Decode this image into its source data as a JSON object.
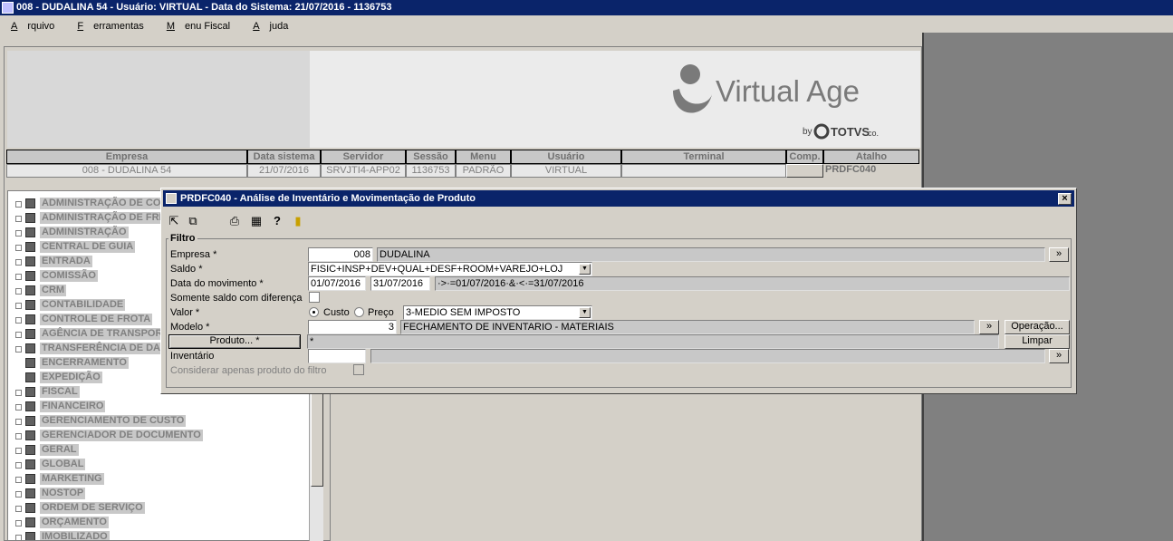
{
  "window": {
    "title": "008 - DUDALINA 54 - Usuário: VIRTUAL - Data do Sistema: 21/07/2016 - 1136753"
  },
  "menu": {
    "items": [
      {
        "first": "A",
        "rest": "rquivo"
      },
      {
        "first": "F",
        "rest": "erramentas"
      },
      {
        "first": "M",
        "rest": "enu Fiscal"
      },
      {
        "first": "A",
        "rest": "juda"
      }
    ]
  },
  "logo": {
    "brand": "Virtual Age",
    "by": "by",
    "partner": "TOTVS",
    "suffix": "co."
  },
  "info": {
    "headers": [
      "Empresa",
      "Data sistema",
      "Servidor",
      "Sessão",
      "Menu",
      "Usuário",
      "Terminal",
      "Comp.",
      "Atalho"
    ],
    "values": [
      "008 - DUDALINA 54",
      "21/07/2016",
      "SRVJTI4-APP02",
      "1136753",
      "PADRÃO",
      "VIRTUAL",
      "",
      "",
      "PRDFC040"
    ]
  },
  "tree": {
    "items": [
      "ADMINISTRAÇÃO DE CO",
      "ADMINISTRAÇÃO DE FRE",
      "ADMINISTRAÇÃO",
      "CENTRAL DE GUIA",
      "ENTRADA",
      "COMISSÃO",
      "CRM",
      "CONTABILIDADE",
      "CONTROLE DE FROTA",
      "AGÊNCIA DE TRANSPORT",
      "TRANSFERÊNCIA DE DADO",
      "ENCERRAMENTO",
      "EXPEDIÇÃO",
      "FISCAL",
      "FINANCEIRO",
      "GERENCIAMENTO DE CUSTO",
      "GERENCIADOR DE DOCUMENTO",
      "GERAL",
      "GLOBAL",
      "MARKETING",
      "NOSTOP",
      "ORDEM DE SERVIÇO",
      "ORÇAMENTO",
      "IMOBILIZADO"
    ]
  },
  "dialog": {
    "title": "PRDFC040 - Análise de Inventário e Movimentação de Produto",
    "close": "×",
    "group": "Filtro",
    "empresa": {
      "label": "Empresa *",
      "code": "008",
      "name": "DUDALINA",
      "btn": "»"
    },
    "saldo": {
      "label": "Saldo *",
      "value": "FISIC+INSP+DEV+QUAL+DESF+ROOM+VAREJO+LOJ"
    },
    "data_mov": {
      "label": "Data do movimento *",
      "from": "01/07/2016",
      "to": "31/07/2016",
      "expr": "·>·=01/07/2016·&·<·=31/07/2016"
    },
    "somente": {
      "label": "Somente saldo com diferença"
    },
    "valor": {
      "label": "Valor *",
      "opt1": "Custo",
      "opt2": "Preço",
      "select": "3-MEDIO SEM IMPOSTO"
    },
    "modelo": {
      "label": "Modelo *",
      "code": "3",
      "name": "FECHAMENTO DE INVENTARIO - MATERIAIS",
      "btn": "»",
      "operacao": "Operação..."
    },
    "produto": {
      "btn": "Produto... *",
      "value": "*",
      "limpar": "Limpar"
    },
    "inventario": {
      "label": "Inventário",
      "btn": "»"
    },
    "considerar": {
      "label": "Considerar apenas produto do filtro"
    }
  }
}
